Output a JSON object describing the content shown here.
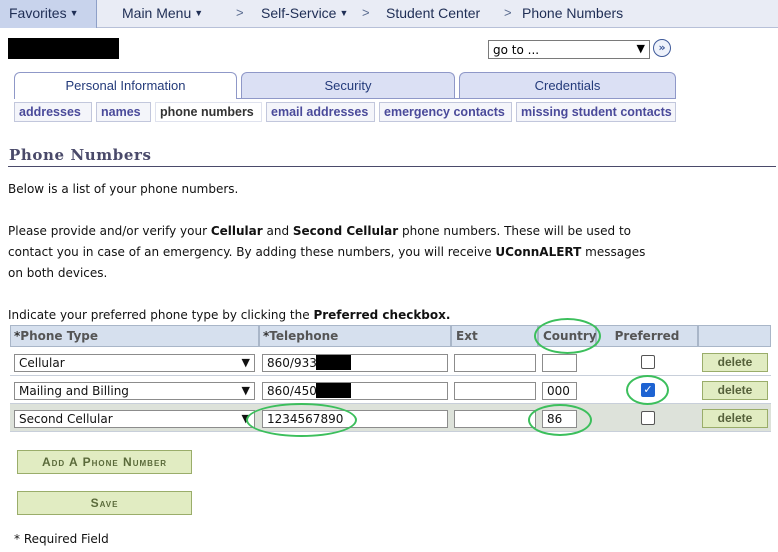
{
  "nav": {
    "favorites": "Favorites",
    "main_menu": "Main Menu",
    "self_service": "Self-Service",
    "student_center": "Student Center",
    "phone_numbers": "Phone Numbers",
    "separator": ">"
  },
  "goto": {
    "value": "go to ..."
  },
  "tabs": [
    {
      "label": "Personal Information"
    },
    {
      "label": "Security"
    },
    {
      "label": "Credentials"
    }
  ],
  "subtabs": [
    {
      "label": "addresses"
    },
    {
      "label": "names"
    },
    {
      "label": "phone numbers"
    },
    {
      "label": "email addresses"
    },
    {
      "label": "emergency contacts"
    },
    {
      "label": "missing student contacts"
    }
  ],
  "page": {
    "title": "Phone Numbers",
    "intro": "Below is a list of your phone numbers.",
    "p2_a": "Please provide and/or verify your ",
    "p2_b": "Cellular",
    "p2_c": " and ",
    "p2_d": "Second Cellular",
    "p2_e": " phone numbers. These will be used to",
    "p2_line2": "contact you in case of an emergency. By adding these numbers, you will receive ",
    "p2_f": "UConnALERT",
    "p2_g": " messages",
    "p2_line3": "on both devices.",
    "p3_a": "Indicate your preferred phone type by clicking the ",
    "p3_b": "Preferred checkbox."
  },
  "table": {
    "headers": {
      "phone_type": "Phone Type",
      "telephone": "Telephone",
      "ext": "Ext",
      "country": "Country",
      "preferred": "Preferred",
      "required_mark": "*"
    },
    "rows": [
      {
        "type": "Cellular",
        "telephone": "860/933-",
        "ext": "",
        "country": "",
        "preferred": false,
        "delete": "delete"
      },
      {
        "type": "Mailing and Billing",
        "telephone": "860/450-",
        "ext": "",
        "country": "000",
        "preferred": true,
        "delete": "delete"
      },
      {
        "type": "Second Cellular",
        "telephone": "1234567890",
        "ext": "",
        "country": "86",
        "preferred": false,
        "delete": "delete"
      }
    ]
  },
  "buttons": {
    "add_phone": "Add A Phone Number",
    "save": "Save"
  },
  "footer": {
    "required_note": "* Required Field"
  },
  "colors": {
    "annotation": "#3cbf5c",
    "button_bg": "#e1ecc2",
    "header_bg": "#d6e0ee",
    "checkbox_checked": "#1e63d2"
  }
}
